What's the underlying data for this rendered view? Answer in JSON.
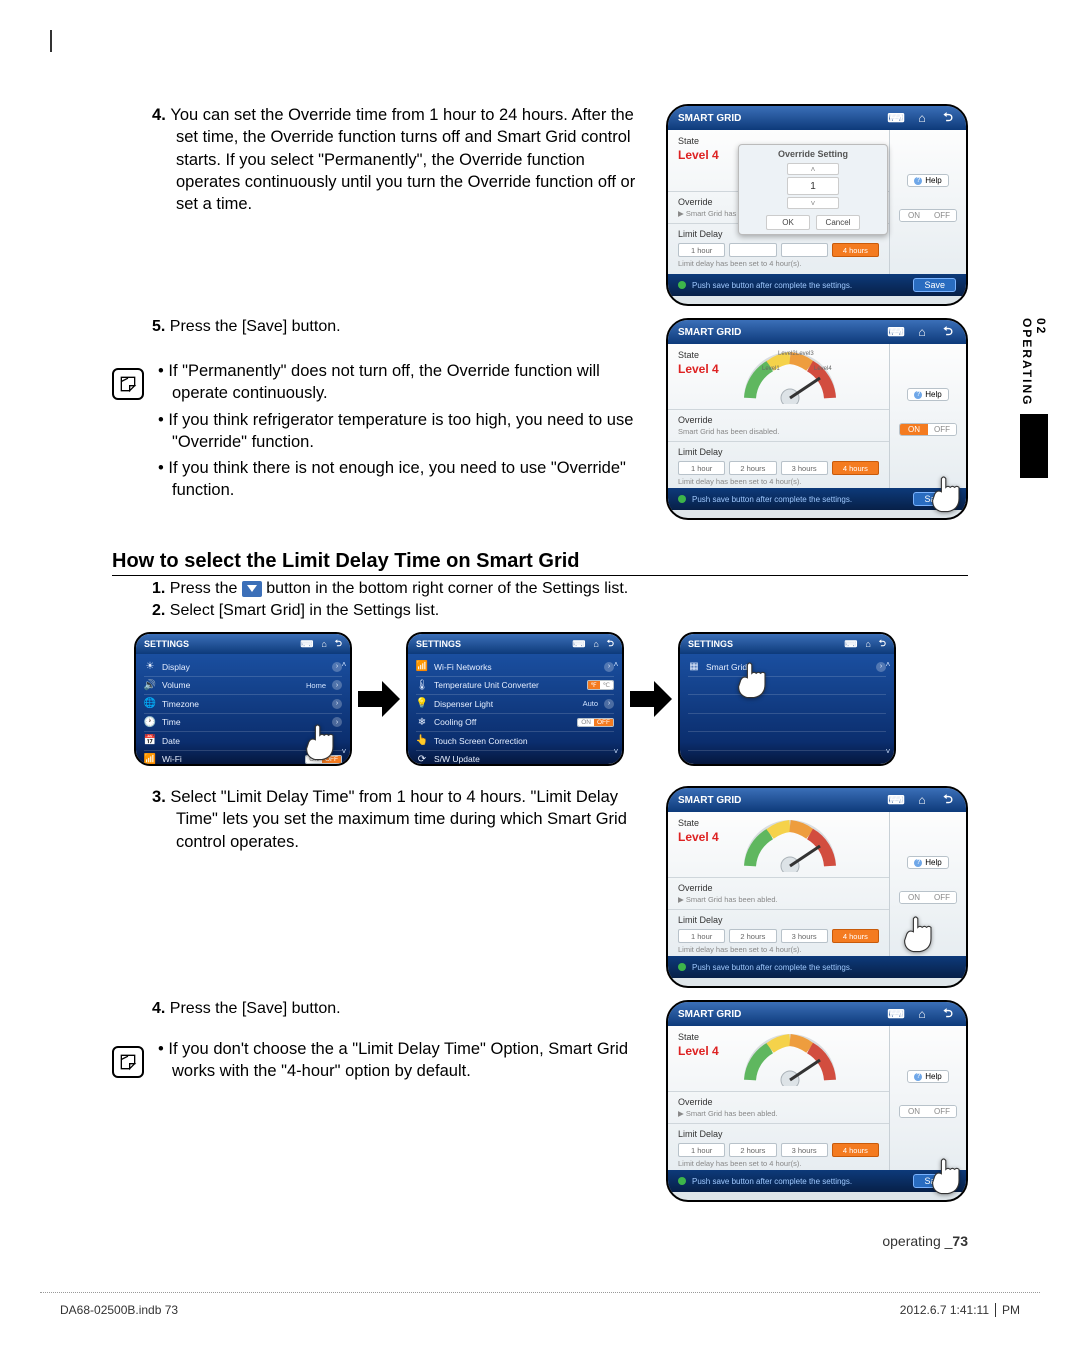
{
  "sideTab": "02 OPERATING",
  "steps_a": {
    "s4": "You can set the Override time from 1 hour to 24 hours. After the set time, the Override function turns off and Smart Grid control starts. If you select \"Permanently\", the Override function operates continuously until you turn the Override function off or set a time.",
    "s5": "Press the [Save] button."
  },
  "note_a": {
    "n1": "If \"Permanently\" does not turn off, the Override function will operate continuously.",
    "n2": "If you think refrigerator temperature is too high, you need to use \"Override\" function.",
    "n3": "If you think there is not enough ice, you need to use \"Override\" function."
  },
  "section_title": "How to select the Limit Delay Time on Smart Grid",
  "steps_b": {
    "s1a": "Press the ",
    "s1b": " button in the bottom right corner of the Settings list.",
    "s2": "Select [Smart Grid] in the Settings list."
  },
  "steps_c": {
    "s3": "Select \"Limit Delay Time\" from 1 hour to 4 hours. \"Limit Delay Time\" lets you set the maximum time during which Smart Grid control operates.",
    "s4": "Press the [Save] button."
  },
  "note_b": {
    "n1": "If you don't choose the a \"Limit Delay Time\" Option, Smart Grid works with the \"4-hour\" option by default."
  },
  "panel": {
    "title": "SMART GRID",
    "state": "State",
    "level": "Level 4",
    "override": "Override",
    "ov_sub_disabled": "Smart Grid has been disabled.",
    "ov_sub_abled": "▶ Smart Grid has been abled.",
    "ov_sub_ab": "▶ Smart Grid has been ab...",
    "limit_delay": "Limit Delay",
    "limit_note": "Limit delay has been set to 4 hour(s).",
    "foot_hint": "Push save button after complete the settings.",
    "help": "Help",
    "on": "ON",
    "off": "OFF",
    "save": "Save",
    "delay_opts": [
      "1 hour",
      "2 hours",
      "3 hours",
      "4 hours"
    ],
    "popup": {
      "title": "Override Setting",
      "value": "1",
      "ok": "OK",
      "cancel": "Cancel"
    },
    "gauge": {
      "l1": "Level1",
      "l2": "Level2",
      "l3": "Level3",
      "l4": "Level4"
    }
  },
  "settings": {
    "title": "SETTINGS",
    "list1": [
      "Display",
      "Volume",
      "Timezone",
      "Time",
      "Date",
      "Wi-Fi"
    ],
    "list1_tags": [
      "",
      "Home",
      "",
      "",
      "",
      ""
    ],
    "list2": [
      "Wi-Fi Networks",
      "Temperature Unit Converter",
      "Dispenser Light",
      "Cooling Off",
      "Touch Screen Correction",
      "S/W Update"
    ],
    "list2_tag_auto": "Auto",
    "list3_item": "Smart Grid"
  },
  "footer": {
    "label": "operating _",
    "pagenum": "73",
    "file": "DA68-02500B.indb   73",
    "date": "2012.6.7   1:41:11",
    "ampm": "PM"
  }
}
